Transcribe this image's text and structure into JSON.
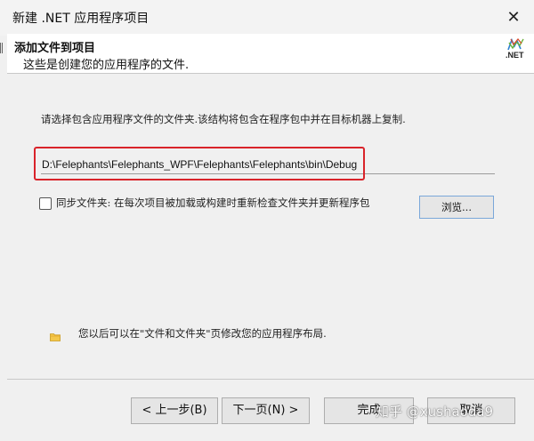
{
  "window": {
    "title": "新建 .NET 应用程序项目",
    "close_glyph": "✕"
  },
  "header": {
    "title": "添加文件到项目",
    "subtitle": "这些是创建您的应用程序的文件.",
    "logo_text": ".NET",
    "logo_icon": "dotnet-logo-icon"
  },
  "main": {
    "instruction": "请选择包含应用程序文件的文件夹.该结构将包含在程序包中并在目标机器上复制.",
    "path_value": "D:\\Felephants\\Felephants_WPF\\Felephants\\Felephants\\bin\\Debug",
    "highlight_color": "#d9232a",
    "sync_checked": false,
    "sync_label": "同步文件夹: 在每次项目被加载或构建时重新检查文件夹并更新程序包",
    "browse_label": "浏览...",
    "info_icon": "folder-icon",
    "info_text": "您以后可以在\"文件和文件夹\"页修改您的应用程序布局."
  },
  "footer": {
    "back_label": "< 上一步(B)",
    "next_label": "下一页(N) >",
    "finish_label": "完成",
    "cancel_label": "取消"
  },
  "watermark": "知乎 @xushaoda9"
}
